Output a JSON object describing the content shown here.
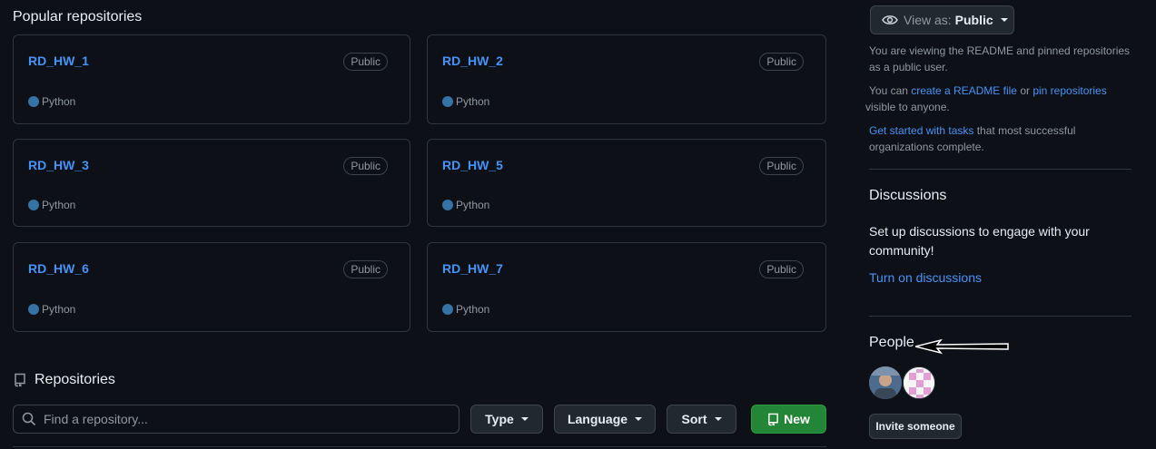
{
  "main": {
    "popular_title": "Popular repositories",
    "repos": [
      {
        "name": "RD_HW_1",
        "visibility": "Public",
        "language": "Python"
      },
      {
        "name": "RD_HW_2",
        "visibility": "Public",
        "language": "Python"
      },
      {
        "name": "RD_HW_3",
        "visibility": "Public",
        "language": "Python"
      },
      {
        "name": "RD_HW_5",
        "visibility": "Public",
        "language": "Python"
      },
      {
        "name": "RD_HW_6",
        "visibility": "Public",
        "language": "Python"
      },
      {
        "name": "RD_HW_7",
        "visibility": "Public",
        "language": "Python"
      }
    ],
    "repositories_title": "Repositories",
    "search_placeholder": "Find a repository...",
    "filters": {
      "type": "Type",
      "language": "Language",
      "sort": "Sort"
    },
    "new_label": "New"
  },
  "sidebar": {
    "view_as_prefix": "View as:",
    "view_as_value": "Public",
    "readme_text": "You are viewing the README and pinned repositories as a public user.",
    "can_prefix": "You can ",
    "create_readme_link": "create a README file",
    "or_text": " or ",
    "pin_repos_link": "pin repositories",
    "visible_text": " visible to anyone.",
    "get_started_link": "Get started with tasks",
    "get_started_rest": " that most successful organizations complete.",
    "discussions_title": "Discussions",
    "discussions_text": "Set up discussions to engage with your community!",
    "turn_on_link": "Turn on discussions",
    "people_title": "People",
    "invite_label": "Invite someone"
  },
  "colors": {
    "accent": "#4493f8",
    "python": "#3572a5",
    "new_button": "#238636"
  }
}
